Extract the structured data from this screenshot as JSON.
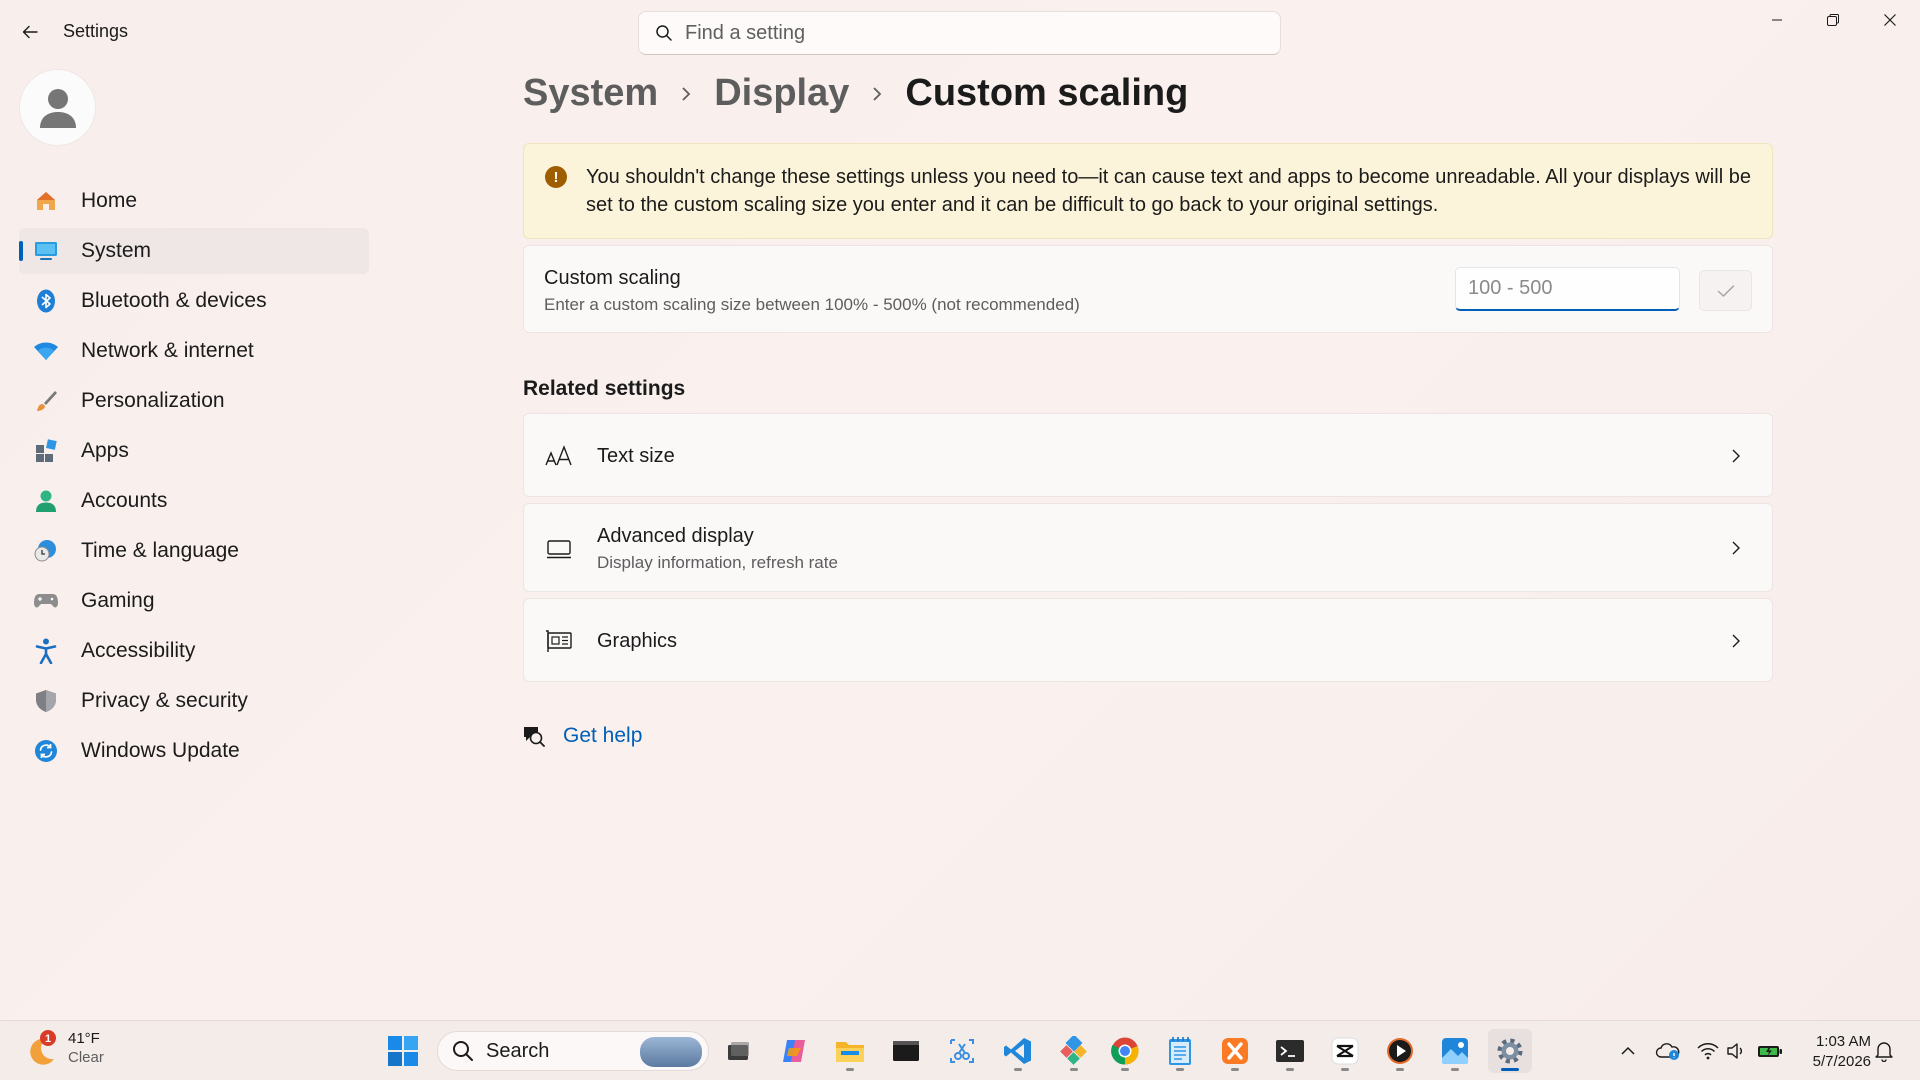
{
  "window": {
    "app_title": "Settings",
    "search_placeholder": "Find a setting"
  },
  "sidebar": {
    "items": [
      {
        "label": "Home",
        "icon": "home-icon"
      },
      {
        "label": "System",
        "icon": "system-icon",
        "active": true
      },
      {
        "label": "Bluetooth & devices",
        "icon": "bluetooth-icon"
      },
      {
        "label": "Network & internet",
        "icon": "wifi-icon"
      },
      {
        "label": "Personalization",
        "icon": "brush-icon"
      },
      {
        "label": "Apps",
        "icon": "apps-icon"
      },
      {
        "label": "Accounts",
        "icon": "accounts-icon"
      },
      {
        "label": "Time & language",
        "icon": "clock-globe-icon"
      },
      {
        "label": "Gaming",
        "icon": "gamepad-icon"
      },
      {
        "label": "Accessibility",
        "icon": "accessibility-icon"
      },
      {
        "label": "Privacy & security",
        "icon": "shield-icon"
      },
      {
        "label": "Windows Update",
        "icon": "update-icon"
      }
    ]
  },
  "breadcrumb": {
    "items": [
      "System",
      "Display",
      "Custom scaling"
    ]
  },
  "warning": {
    "text": "You shouldn't change these settings unless you need to—it can cause text and apps to become unreadable. All your displays will be set to the custom scaling size you enter and it can be difficult to go back to your original settings."
  },
  "custom_scaling": {
    "title": "Custom scaling",
    "subtitle": "Enter a custom scaling size between 100% - 500% (not recommended)",
    "input_placeholder": "100 - 500",
    "input_value": ""
  },
  "related": {
    "title": "Related settings",
    "items": [
      {
        "title": "Text size",
        "subtitle": "",
        "icon": "text-size-icon"
      },
      {
        "title": "Advanced display",
        "subtitle": "Display information, refresh rate",
        "icon": "monitor-icon"
      },
      {
        "title": "Graphics",
        "subtitle": "",
        "icon": "graphics-card-icon"
      }
    ]
  },
  "help": {
    "label": "Get help"
  },
  "taskbar": {
    "weather": {
      "temp": "41°F",
      "condition": "Clear",
      "badge": "1"
    },
    "search_label": "Search",
    "clock": {
      "time": "1:03 AM",
      "date": "5/7/2026"
    }
  },
  "colors": {
    "accent": "#005fb8",
    "warning_bg": "#fcf4da",
    "warning_icon": "#9d5d00"
  }
}
